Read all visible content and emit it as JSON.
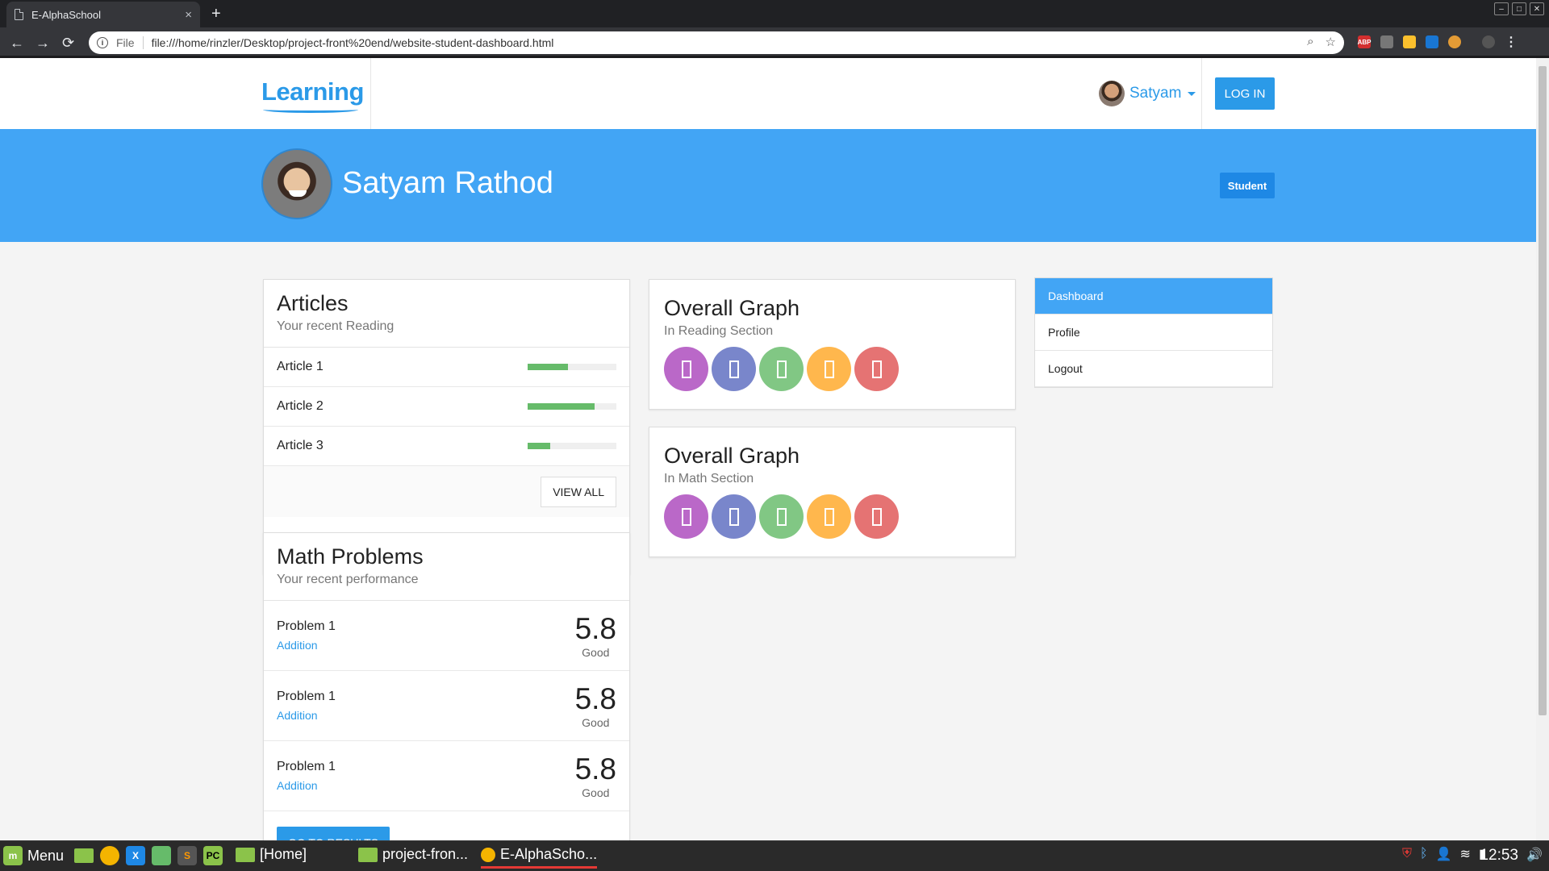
{
  "browser": {
    "tab_title": "E-AlphaSchool",
    "tab_close": "×",
    "new_tab": "+",
    "back": "←",
    "forward": "→",
    "reload": "⟳",
    "info": "i",
    "scheme": "File",
    "url": "file:///home/rinzler/Desktop/project-front%20end/website-student-dashboard.html",
    "zoom_icon": "⌕",
    "star_icon": "☆",
    "menu_icon": "⋮",
    "window_controls": [
      "–",
      "□",
      "✕"
    ],
    "extensions": [
      {
        "name": "adblock-icon",
        "label": "ABP",
        "color": "#d32f2f"
      },
      {
        "name": "camera-icon",
        "label": "",
        "color": "#777"
      },
      {
        "name": "color-picker-icon",
        "label": "",
        "color": "#fbc02d"
      },
      {
        "name": "screen-icon",
        "label": "",
        "color": "#1976d2"
      },
      {
        "name": "cookie-icon",
        "label": "",
        "color": "#e39b35"
      }
    ]
  },
  "nav": {
    "logo": "Learning",
    "user_name": "Satyam",
    "login": "LOG IN"
  },
  "hero": {
    "name": "Satyam Rathod",
    "role": "Student"
  },
  "articles": {
    "title": "Articles",
    "subtitle": "Your recent Reading",
    "items": [
      {
        "label": "Article 1",
        "progress": 0.45
      },
      {
        "label": "Article 2",
        "progress": 0.75
      },
      {
        "label": "Article 3",
        "progress": 0.25
      }
    ],
    "view_all": "VIEW ALL"
  },
  "math": {
    "title": "Math Problems",
    "subtitle": "Your recent performance",
    "items": [
      {
        "name": "Problem 1",
        "category": "Addition",
        "score": "5.8",
        "level": "Good"
      },
      {
        "name": "Problem 1",
        "category": "Addition",
        "score": "5.8",
        "level": "Good"
      },
      {
        "name": "Problem 1",
        "category": "Addition",
        "score": "5.8",
        "level": "Good"
      }
    ],
    "results_button": "GO TO RESULTS"
  },
  "graphs": [
    {
      "title": "Overall Graph",
      "subtitle": "In Reading Section"
    },
    {
      "title": "Overall Graph",
      "subtitle": "In Math Section"
    }
  ],
  "circle_colors": [
    "#ba68c8",
    "#7986cb",
    "#81c784",
    "#ffb74d",
    "#e57373"
  ],
  "sidebar": {
    "items": [
      {
        "label": "Dashboard",
        "active": true
      },
      {
        "label": "Profile",
        "active": false
      },
      {
        "label": "Logout",
        "active": false
      }
    ]
  },
  "taskbar": {
    "menu": "Menu",
    "home": "[Home]",
    "project": "project-fron...",
    "browser": "E-AlphaScho...",
    "clock": "12:53"
  },
  "colors": {
    "primary": "#42a5f5",
    "accent": "#2b9ae8",
    "progress": "#66bb6a"
  }
}
